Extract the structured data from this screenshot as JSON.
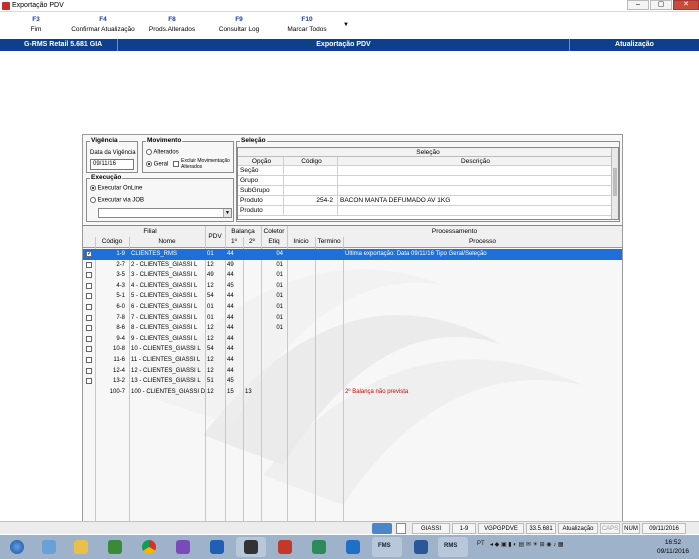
{
  "window": {
    "title": "Exportação PDV",
    "controls": [
      "–",
      "▢",
      "✕"
    ]
  },
  "toolbar": {
    "items": [
      {
        "key": "F3",
        "label": "Fim"
      },
      {
        "key": "F4",
        "label": "Confirmar Atualização"
      },
      {
        "key": "F8",
        "label": "Prods.Alterados"
      },
      {
        "key": "F9",
        "label": "Consultar Log"
      },
      {
        "key": "F10",
        "label": "Marcar Todos"
      }
    ],
    "more": "▼"
  },
  "header": {
    "product": "G-RMS Retail 5.681 GIA",
    "screen": "Exportação PDV",
    "mode": "Atualização"
  },
  "vigencia": {
    "legend": "Vigência",
    "label": "Data da Vigência",
    "value": "09/11/16"
  },
  "movimento": {
    "legend": "Movimento",
    "opt_alterados": "Alterados",
    "opt_geral": "Geral",
    "excluir_label": "Excluir Movimentação Alterados"
  },
  "execucao": {
    "legend": "Execução",
    "opt_online": "Executar OnLine",
    "opt_job": "Executar via JOB",
    "job_value": ""
  },
  "selecao": {
    "legend": "Seleção",
    "caption": "Seleção",
    "headers": {
      "opcao": "Opção",
      "codigo": "Código",
      "descricao": "Descrição"
    },
    "rows": [
      {
        "opcao": "Seção",
        "codigo": "",
        "descricao": ""
      },
      {
        "opcao": "Grupo",
        "codigo": "",
        "descricao": ""
      },
      {
        "opcao": "SubGrupo",
        "codigo": "",
        "descricao": ""
      },
      {
        "opcao": "Produto",
        "codigo": "254-2",
        "descricao": "BACON MANTA DEFUMADO        AV   1KG"
      },
      {
        "opcao": "Produto",
        "codigo": "",
        "descricao": ""
      }
    ]
  },
  "grid": {
    "headers": {
      "filial": "Filial",
      "codigo": "Código",
      "nome": "Nome",
      "pdv": "PDV",
      "balanca": "Balança",
      "b1": "1º",
      "b2": "2º",
      "coletor": "Coletor",
      "etiq": "Etiq",
      "processamento": "Processamento",
      "inicio": "Inicio",
      "termino": "Termino",
      "processo": "Processo"
    },
    "rows": [
      {
        "checked": true,
        "codigo": "1-9",
        "nome": "CLIENTES_RMS",
        "pdv": "01",
        "b1": "44",
        "b2": "",
        "etiq": "04",
        "processo": "Última exportação: Data 09/11/16 Tipo Geral/Seleção",
        "alert": false
      },
      {
        "checked": false,
        "codigo": "2-7",
        "nome": "2 - CLIENTES_GIASSI L",
        "pdv": "12",
        "b1": "49",
        "b2": "",
        "etiq": "01",
        "processo": "",
        "alert": false
      },
      {
        "checked": false,
        "codigo": "3-5",
        "nome": "3 - CLIENTES_GIASSI L",
        "pdv": "49",
        "b1": "44",
        "b2": "",
        "etiq": "01",
        "processo": "",
        "alert": false
      },
      {
        "checked": false,
        "codigo": "4-3",
        "nome": "4 - CLIENTES_GIASSI L",
        "pdv": "12",
        "b1": "45",
        "b2": "",
        "etiq": "01",
        "processo": "",
        "alert": false
      },
      {
        "checked": false,
        "codigo": "5-1",
        "nome": "5 - CLIENTES_GIASSI L",
        "pdv": "54",
        "b1": "44",
        "b2": "",
        "etiq": "01",
        "processo": "",
        "alert": false
      },
      {
        "checked": false,
        "codigo": "6-0",
        "nome": "6 - CLIENTES_GIASSI L",
        "pdv": "01",
        "b1": "44",
        "b2": "",
        "etiq": "01",
        "processo": "",
        "alert": false
      },
      {
        "checked": false,
        "codigo": "7-8",
        "nome": "7 - CLIENTES_GIASSI L",
        "pdv": "01",
        "b1": "44",
        "b2": "",
        "etiq": "01",
        "processo": "",
        "alert": false
      },
      {
        "checked": false,
        "codigo": "8-6",
        "nome": "8 - CLIENTES_GIASSI L",
        "pdv": "12",
        "b1": "44",
        "b2": "",
        "etiq": "01",
        "processo": "",
        "alert": false
      },
      {
        "checked": false,
        "codigo": "9-4",
        "nome": "9 - CLIENTES_GIASSI L",
        "pdv": "12",
        "b1": "44",
        "b2": "",
        "etiq": "",
        "processo": "",
        "alert": false
      },
      {
        "checked": false,
        "codigo": "10-8",
        "nome": "10 - CLIENTES_GIASSI L",
        "pdv": "54",
        "b1": "44",
        "b2": "",
        "etiq": "",
        "processo": "",
        "alert": false
      },
      {
        "checked": false,
        "codigo": "11-6",
        "nome": "11 - CLIENTES_GIASSI L",
        "pdv": "12",
        "b1": "44",
        "b2": "",
        "etiq": "",
        "processo": "",
        "alert": false
      },
      {
        "checked": false,
        "codigo": "12-4",
        "nome": "12 - CLIENTES_GIASSI L",
        "pdv": "12",
        "b1": "44",
        "b2": "",
        "etiq": "",
        "processo": "",
        "alert": false
      },
      {
        "checked": false,
        "codigo": "13-2",
        "nome": "13 - CLIENTES_GIASSI L",
        "pdv": "51",
        "b1": "45",
        "b2": "",
        "etiq": "",
        "processo": "",
        "alert": false
      },
      {
        "checked": null,
        "codigo": "100-7",
        "nome": "100 - CLIENTES_GIASSI D",
        "pdv": "12",
        "b1": "15",
        "b2": "13",
        "etiq": "",
        "processo": "2º Balança não prevista",
        "alert": true
      }
    ]
  },
  "statusbar": {
    "cells": [
      "GIASSI",
      "1-9",
      "VGPGPDVE",
      "33.5.681",
      "Atualização",
      "CAPS",
      "NUM",
      "09/11/2016"
    ]
  },
  "taskbar": {
    "tray_lang": "PT",
    "time": "16:52",
    "date": "09/11/2016",
    "app_labels": [
      "FMS",
      "RMS"
    ],
    "colors": {
      "accent": "#0d3f8c",
      "selected_row": "#1e6fd9",
      "alert_text": "#d10000"
    }
  }
}
